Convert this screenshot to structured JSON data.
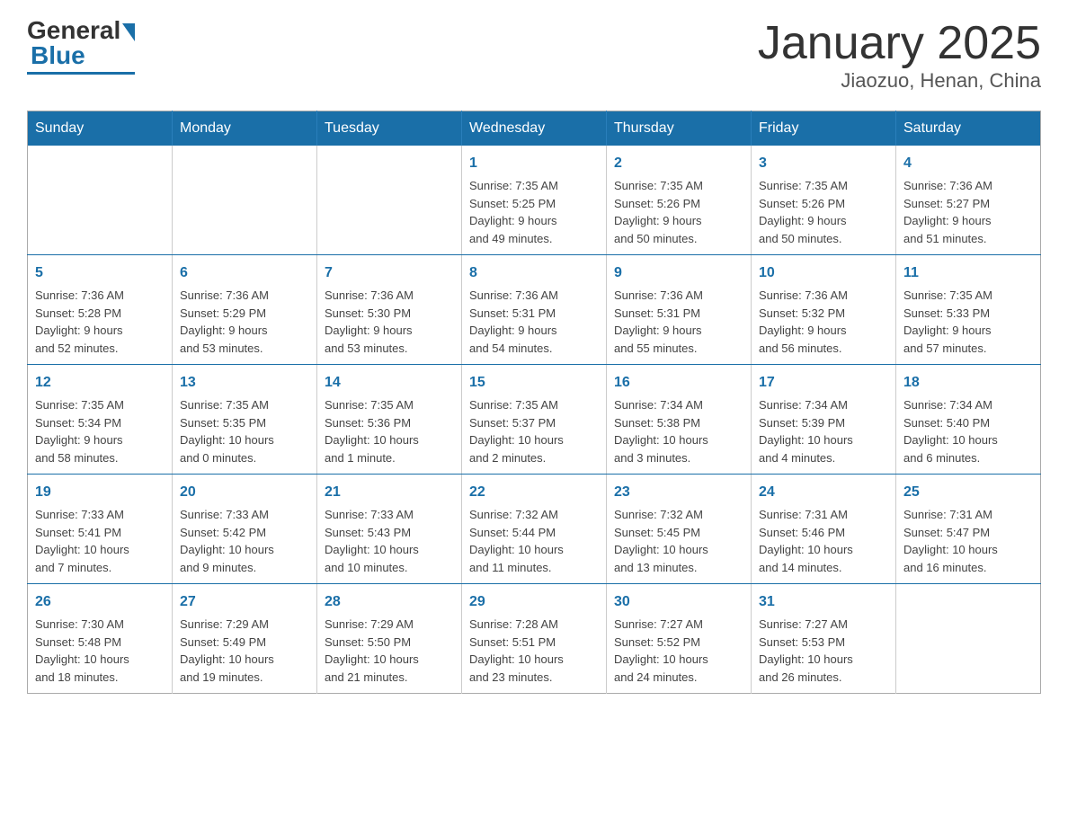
{
  "logo": {
    "general": "General",
    "blue": "Blue"
  },
  "title": "January 2025",
  "subtitle": "Jiaozuo, Henan, China",
  "weekdays": [
    "Sunday",
    "Monday",
    "Tuesday",
    "Wednesday",
    "Thursday",
    "Friday",
    "Saturday"
  ],
  "weeks": [
    [
      {
        "day": "",
        "info": ""
      },
      {
        "day": "",
        "info": ""
      },
      {
        "day": "",
        "info": ""
      },
      {
        "day": "1",
        "info": "Sunrise: 7:35 AM\nSunset: 5:25 PM\nDaylight: 9 hours\nand 49 minutes."
      },
      {
        "day": "2",
        "info": "Sunrise: 7:35 AM\nSunset: 5:26 PM\nDaylight: 9 hours\nand 50 minutes."
      },
      {
        "day": "3",
        "info": "Sunrise: 7:35 AM\nSunset: 5:26 PM\nDaylight: 9 hours\nand 50 minutes."
      },
      {
        "day": "4",
        "info": "Sunrise: 7:36 AM\nSunset: 5:27 PM\nDaylight: 9 hours\nand 51 minutes."
      }
    ],
    [
      {
        "day": "5",
        "info": "Sunrise: 7:36 AM\nSunset: 5:28 PM\nDaylight: 9 hours\nand 52 minutes."
      },
      {
        "day": "6",
        "info": "Sunrise: 7:36 AM\nSunset: 5:29 PM\nDaylight: 9 hours\nand 53 minutes."
      },
      {
        "day": "7",
        "info": "Sunrise: 7:36 AM\nSunset: 5:30 PM\nDaylight: 9 hours\nand 53 minutes."
      },
      {
        "day": "8",
        "info": "Sunrise: 7:36 AM\nSunset: 5:31 PM\nDaylight: 9 hours\nand 54 minutes."
      },
      {
        "day": "9",
        "info": "Sunrise: 7:36 AM\nSunset: 5:31 PM\nDaylight: 9 hours\nand 55 minutes."
      },
      {
        "day": "10",
        "info": "Sunrise: 7:36 AM\nSunset: 5:32 PM\nDaylight: 9 hours\nand 56 minutes."
      },
      {
        "day": "11",
        "info": "Sunrise: 7:35 AM\nSunset: 5:33 PM\nDaylight: 9 hours\nand 57 minutes."
      }
    ],
    [
      {
        "day": "12",
        "info": "Sunrise: 7:35 AM\nSunset: 5:34 PM\nDaylight: 9 hours\nand 58 minutes."
      },
      {
        "day": "13",
        "info": "Sunrise: 7:35 AM\nSunset: 5:35 PM\nDaylight: 10 hours\nand 0 minutes."
      },
      {
        "day": "14",
        "info": "Sunrise: 7:35 AM\nSunset: 5:36 PM\nDaylight: 10 hours\nand 1 minute."
      },
      {
        "day": "15",
        "info": "Sunrise: 7:35 AM\nSunset: 5:37 PM\nDaylight: 10 hours\nand 2 minutes."
      },
      {
        "day": "16",
        "info": "Sunrise: 7:34 AM\nSunset: 5:38 PM\nDaylight: 10 hours\nand 3 minutes."
      },
      {
        "day": "17",
        "info": "Sunrise: 7:34 AM\nSunset: 5:39 PM\nDaylight: 10 hours\nand 4 minutes."
      },
      {
        "day": "18",
        "info": "Sunrise: 7:34 AM\nSunset: 5:40 PM\nDaylight: 10 hours\nand 6 minutes."
      }
    ],
    [
      {
        "day": "19",
        "info": "Sunrise: 7:33 AM\nSunset: 5:41 PM\nDaylight: 10 hours\nand 7 minutes."
      },
      {
        "day": "20",
        "info": "Sunrise: 7:33 AM\nSunset: 5:42 PM\nDaylight: 10 hours\nand 9 minutes."
      },
      {
        "day": "21",
        "info": "Sunrise: 7:33 AM\nSunset: 5:43 PM\nDaylight: 10 hours\nand 10 minutes."
      },
      {
        "day": "22",
        "info": "Sunrise: 7:32 AM\nSunset: 5:44 PM\nDaylight: 10 hours\nand 11 minutes."
      },
      {
        "day": "23",
        "info": "Sunrise: 7:32 AM\nSunset: 5:45 PM\nDaylight: 10 hours\nand 13 minutes."
      },
      {
        "day": "24",
        "info": "Sunrise: 7:31 AM\nSunset: 5:46 PM\nDaylight: 10 hours\nand 14 minutes."
      },
      {
        "day": "25",
        "info": "Sunrise: 7:31 AM\nSunset: 5:47 PM\nDaylight: 10 hours\nand 16 minutes."
      }
    ],
    [
      {
        "day": "26",
        "info": "Sunrise: 7:30 AM\nSunset: 5:48 PM\nDaylight: 10 hours\nand 18 minutes."
      },
      {
        "day": "27",
        "info": "Sunrise: 7:29 AM\nSunset: 5:49 PM\nDaylight: 10 hours\nand 19 minutes."
      },
      {
        "day": "28",
        "info": "Sunrise: 7:29 AM\nSunset: 5:50 PM\nDaylight: 10 hours\nand 21 minutes."
      },
      {
        "day": "29",
        "info": "Sunrise: 7:28 AM\nSunset: 5:51 PM\nDaylight: 10 hours\nand 23 minutes."
      },
      {
        "day": "30",
        "info": "Sunrise: 7:27 AM\nSunset: 5:52 PM\nDaylight: 10 hours\nand 24 minutes."
      },
      {
        "day": "31",
        "info": "Sunrise: 7:27 AM\nSunset: 5:53 PM\nDaylight: 10 hours\nand 26 minutes."
      },
      {
        "day": "",
        "info": ""
      }
    ]
  ]
}
